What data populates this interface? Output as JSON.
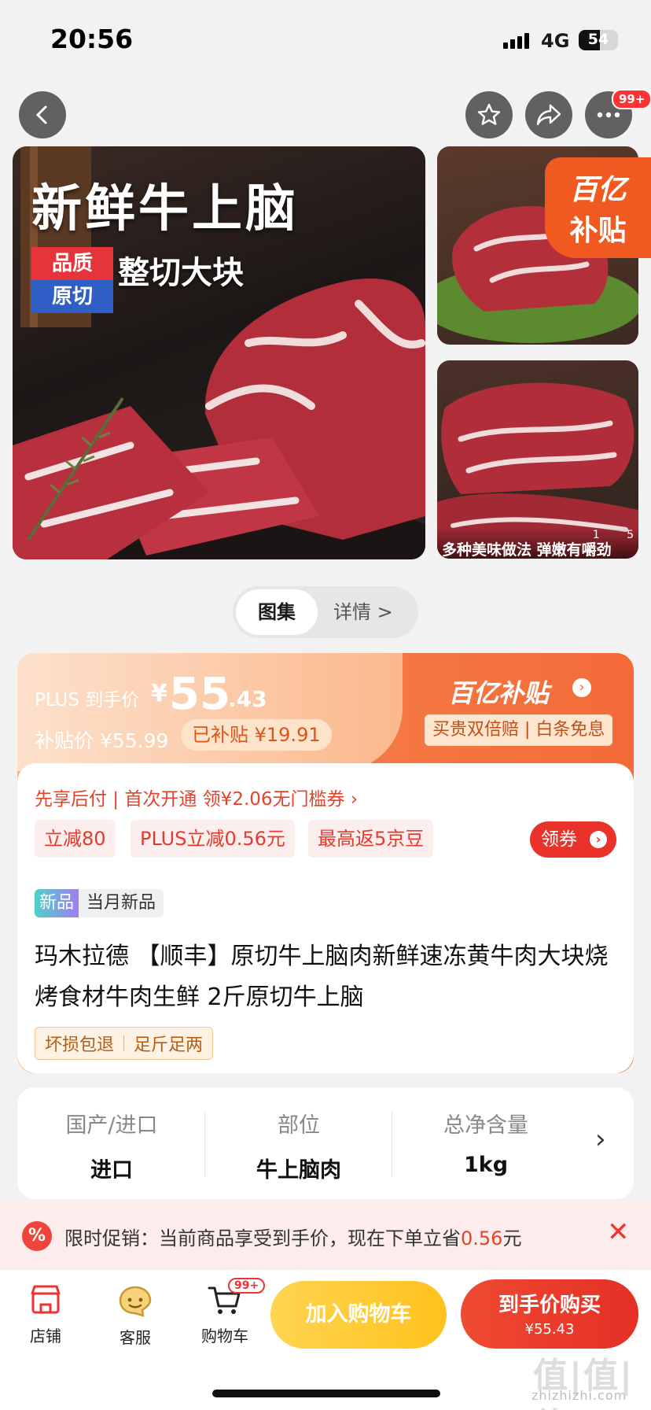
{
  "status_bar": {
    "time": "20:56",
    "network": "4G",
    "battery": "54",
    "battery_level": 0.54
  },
  "top_actions": {
    "cart_badge": "99+"
  },
  "gallery": {
    "main_headline": "新鲜牛上脑",
    "quality_tag_1": "品质",
    "quality_tag_2": "原切",
    "main_tagline": "整切大块",
    "subsidy_corner_1": "百亿",
    "subsidy_corner_2": "补贴",
    "side_caption": "多种美味做法 弹嫩有嚼劲",
    "pager_left": "1",
    "pager_right": "5"
  },
  "segment": {
    "active": "图集",
    "inactive": "详情 >"
  },
  "price": {
    "plus_label": "PLUS 到手价",
    "currency": "¥",
    "amount_int": "55",
    "amount_dec": ".43",
    "subsidy_price": "补贴价 ¥55.99",
    "subsidy_pill": "已补贴 ¥19.91",
    "brand": "百亿补贴",
    "brand_arrow": "›",
    "guarantee": "买贵双倍赔 | 白条免息"
  },
  "offers": {
    "pay_later": "先享后付 | 首次开通 领¥2.06无门槛券 ›",
    "chips": [
      "立减80",
      "PLUS立减0.56元",
      "最高返5京豆"
    ],
    "coupon_button": "领券",
    "coupon_arrow": "›"
  },
  "product": {
    "new_badge": "新品",
    "new_label": "当月新品",
    "title": "玛木拉德 【顺丰】原切牛上脑肉新鲜速冻黄牛肉大块烧烤食材牛肉生鲜 2斤原切牛上脑",
    "perks": [
      "坏损包退",
      "足斤足两"
    ]
  },
  "specs": [
    {
      "key": "国产/进口",
      "value": "进口"
    },
    {
      "key": "部位",
      "value": "牛上脑肉"
    },
    {
      "key": "总净含量",
      "value": "1kg"
    }
  ],
  "promo_bar": {
    "icon": "%",
    "text": "限时促销：当前商品享受到手价，现在下单立省",
    "amount": "0.56",
    "unit": "元",
    "close": "✕"
  },
  "bottom_bar": {
    "shop": "店铺",
    "service": "客服",
    "cart": "购物车",
    "cart_badge": "99+",
    "add_to_cart": "加入购物车",
    "buy_now": "到手价购买",
    "buy_price": "¥55.43"
  },
  "watermark": {
    "main": "值|值|值",
    "sub": "zhizhizhi.com"
  },
  "colors": {
    "accent": "#e9332a",
    "orange": "#f4804a",
    "yellow": "#ffc21d"
  }
}
